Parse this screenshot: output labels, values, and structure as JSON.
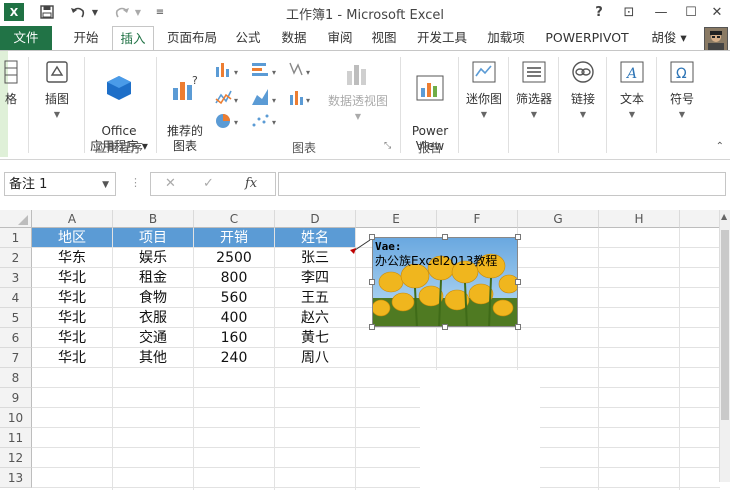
{
  "window": {
    "title": "工作簿1 - Microsoft Excel",
    "app_logo": "X",
    "help": "?",
    "restore": "⊡",
    "minimize": "—",
    "maximize": "☐",
    "close": "✕"
  },
  "tabs": [
    {
      "label": "文件"
    },
    {
      "label": "开始"
    },
    {
      "label": "插入"
    },
    {
      "label": "页面布局"
    },
    {
      "label": "公式"
    },
    {
      "label": "数据"
    },
    {
      "label": "审阅"
    },
    {
      "label": "视图"
    },
    {
      "label": "开发工具"
    },
    {
      "label": "加载项"
    },
    {
      "label": "POWERPIVOT"
    },
    {
      "label": "胡俊 ▾"
    }
  ],
  "ribbon": {
    "illustrations_partial": "格",
    "illustrations": "插图",
    "office_apps": "Office\n应用程序 ▾",
    "recommended_charts": "推荐的\n图表",
    "pivotchart": "数据透视图",
    "power_view": "Power\nView",
    "sparklines": "迷你图",
    "slicer": "筛选器",
    "link": "链接",
    "text": "文本",
    "symbols": "符号",
    "group_apps": "应用程序",
    "group_charts": "图表",
    "group_reports": "报告"
  },
  "formula_bar": {
    "name_box": "备注 1",
    "name_dd": "▼",
    "cancel": "✕",
    "confirm": "✓",
    "fx": "fx",
    "value": ""
  },
  "sheet": {
    "columns": [
      "A",
      "B",
      "C",
      "D",
      "E",
      "F",
      "G",
      "H"
    ],
    "rows": [
      "1",
      "2",
      "3",
      "4",
      "5",
      "6",
      "7",
      "8",
      "9",
      "10",
      "11",
      "12",
      "13"
    ],
    "header": [
      "地区",
      "项目",
      "开销",
      "姓名"
    ],
    "data": [
      [
        "华东",
        "娱乐",
        "2500",
        "张三"
      ],
      [
        "华北",
        "租金",
        "800",
        "李四"
      ],
      [
        "华北",
        "食物",
        "560",
        "王五"
      ],
      [
        "华北",
        "衣服",
        "400",
        "赵六"
      ],
      [
        "华北",
        "交通",
        "160",
        "黄七"
      ],
      [
        "华北",
        "其他",
        "240",
        "周八"
      ]
    ]
  },
  "comment": {
    "author": "Vae:",
    "text": "办公族Excel2013教程"
  },
  "colors": {
    "excel_green": "#217346",
    "header_fill": "#5b9bd5"
  }
}
